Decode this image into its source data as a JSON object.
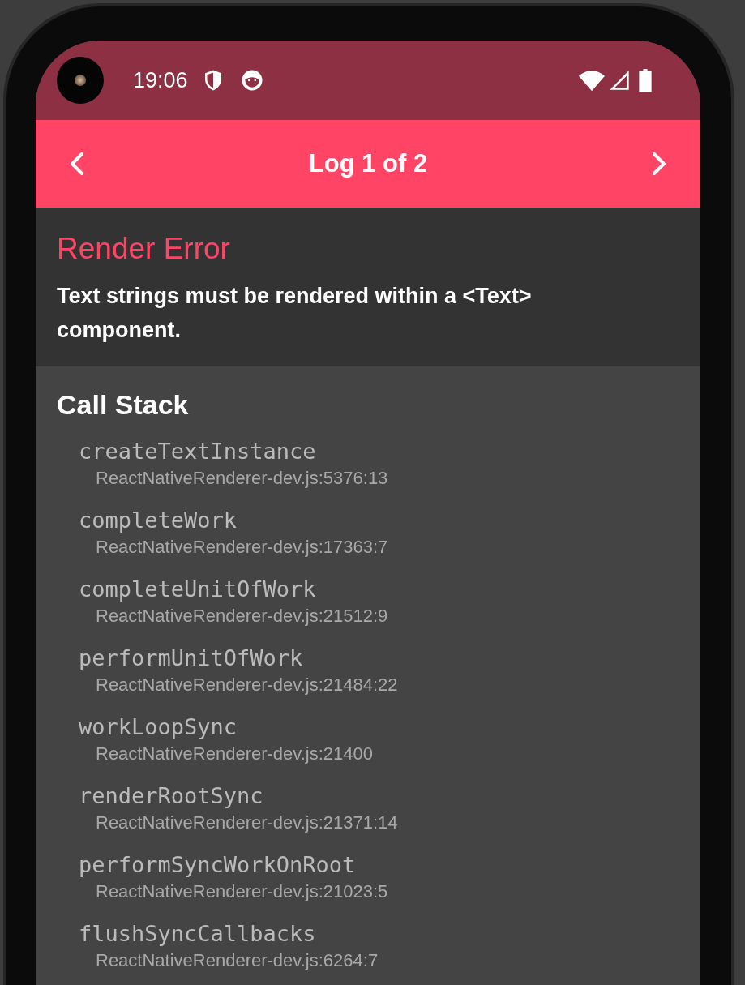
{
  "status_bar": {
    "time": "19:06"
  },
  "header": {
    "title": "Log 1 of 2"
  },
  "error": {
    "title": "Render Error",
    "message": "Text strings must be rendered within a <Text> component."
  },
  "call_stack": {
    "title": "Call Stack",
    "frames": [
      {
        "method": "createTextInstance",
        "location": "ReactNativeRenderer-dev.js:5376:13"
      },
      {
        "method": "completeWork",
        "location": "ReactNativeRenderer-dev.js:17363:7"
      },
      {
        "method": "completeUnitOfWork",
        "location": "ReactNativeRenderer-dev.js:21512:9"
      },
      {
        "method": "performUnitOfWork",
        "location": "ReactNativeRenderer-dev.js:21484:22"
      },
      {
        "method": "workLoopSync",
        "location": "ReactNativeRenderer-dev.js:21400"
      },
      {
        "method": "renderRootSync",
        "location": "ReactNativeRenderer-dev.js:21371:14"
      },
      {
        "method": "performSyncWorkOnRoot",
        "location": "ReactNativeRenderer-dev.js:21023:5"
      },
      {
        "method": "flushSyncCallbacks",
        "location": "ReactNativeRenderer-dev.js:6264:7"
      }
    ]
  }
}
